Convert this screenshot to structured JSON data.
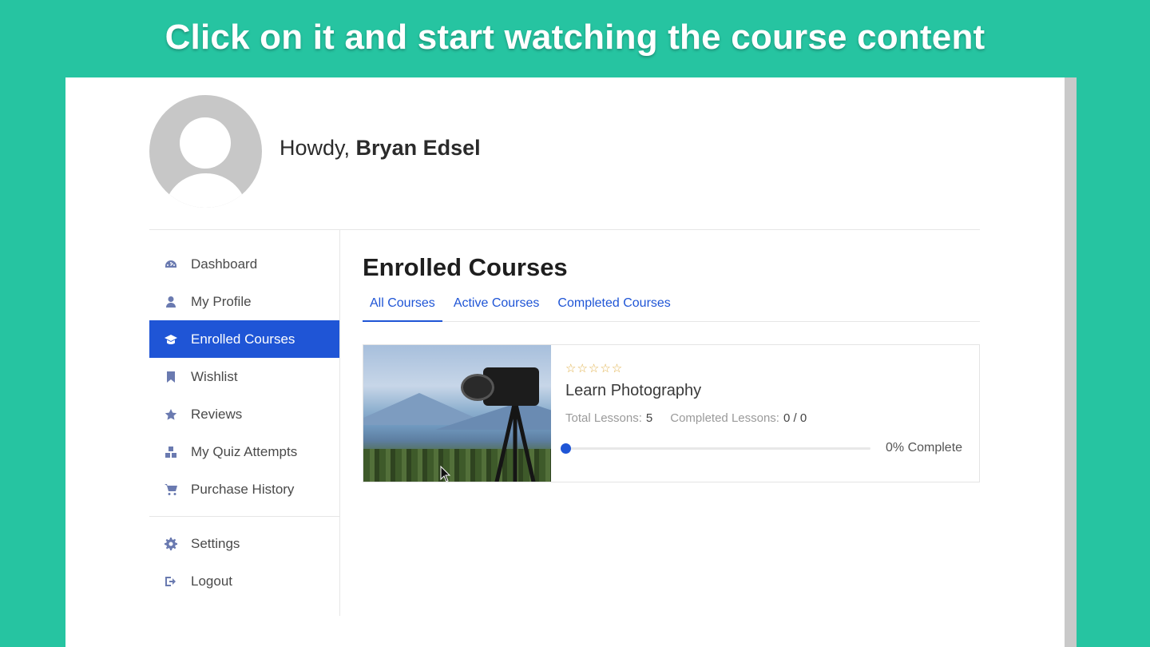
{
  "banner": "Click on it and start watching the course content",
  "user": {
    "greeting": "Howdy,",
    "name": "Bryan Edsel"
  },
  "sidebar": {
    "items": [
      {
        "label": "Dashboard",
        "icon": "dashboard-icon"
      },
      {
        "label": "My Profile",
        "icon": "user-icon"
      },
      {
        "label": "Enrolled Courses",
        "icon": "graduation-cap-icon",
        "active": true
      },
      {
        "label": "Wishlist",
        "icon": "bookmark-icon"
      },
      {
        "label": "Reviews",
        "icon": "star-icon"
      },
      {
        "label": "My Quiz Attempts",
        "icon": "quiz-icon"
      },
      {
        "label": "Purchase History",
        "icon": "cart-icon"
      }
    ],
    "bottom": [
      {
        "label": "Settings",
        "icon": "gear-icon"
      },
      {
        "label": "Logout",
        "icon": "logout-icon"
      }
    ]
  },
  "main": {
    "title": "Enrolled Courses",
    "tabs": [
      {
        "label": "All Courses",
        "active": true
      },
      {
        "label": "Active Courses"
      },
      {
        "label": "Completed Courses"
      }
    ]
  },
  "course": {
    "rating": "☆☆☆☆☆",
    "title": "Learn Photography",
    "total_lessons_label": "Total Lessons:",
    "total_lessons": "5",
    "completed_lessons_label": "Completed Lessons:",
    "completed_lessons": "0 / 0",
    "progress": 0,
    "progress_label": "0% Complete"
  },
  "colors": {
    "background": "#26c4a1",
    "accent": "#1f55d6",
    "star": "#e0b04a"
  }
}
